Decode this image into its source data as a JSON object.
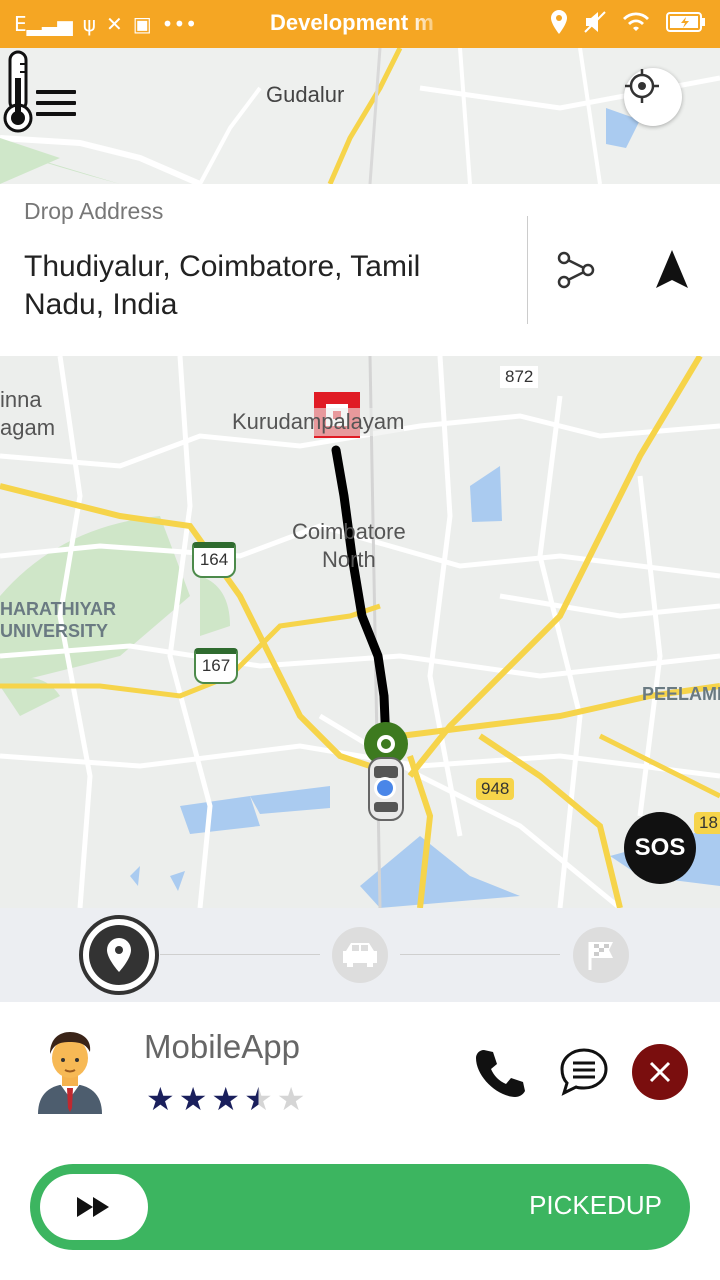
{
  "status_bar": {
    "title": "Development m",
    "left_icons": [
      "signal-e-icon",
      "usb-icon",
      "tools-icon",
      "app-icon",
      "more-icon"
    ],
    "right_icons": [
      "location-icon",
      "mute-icon",
      "wifi-icon",
      "battery-icon"
    ],
    "background": "#f5a623"
  },
  "top_map": {
    "label": "Gudalur",
    "menu_icon": "hamburger-menu-icon",
    "thermometer_icon": "thermometer-icon",
    "locate_icon": "locate-me-icon"
  },
  "drop": {
    "label": "Drop Address",
    "address": "Thudiyalur, Coimbatore, Tamil Nadu, India",
    "share_icon": "share-icon",
    "navigate_icon": "navigation-arrow-icon"
  },
  "map": {
    "labels": {
      "chinna": "inna\nagam",
      "kurudam": "Kurudampalayam",
      "coimbatore": "Coimbatore\nNorth",
      "university": "HARATHIYAR\nUNIVERSITY",
      "peelame": "PEELAME"
    },
    "shields": {
      "s872": "872",
      "s164": "164",
      "s167": "167",
      "s948": "948",
      "s18": "18"
    },
    "sos_label": "SOS"
  },
  "steps": {
    "icons": [
      "pin-icon",
      "car-icon",
      "finish-flag-icon"
    ],
    "active_index": 0
  },
  "driver": {
    "name": "MobileApp",
    "rating": 3.5,
    "rating_max": 5,
    "accent": "#1a1f5c",
    "cancel_color": "#7a0e0e"
  },
  "slider": {
    "label": "PICKEDUP",
    "color": "#3cb560"
  }
}
